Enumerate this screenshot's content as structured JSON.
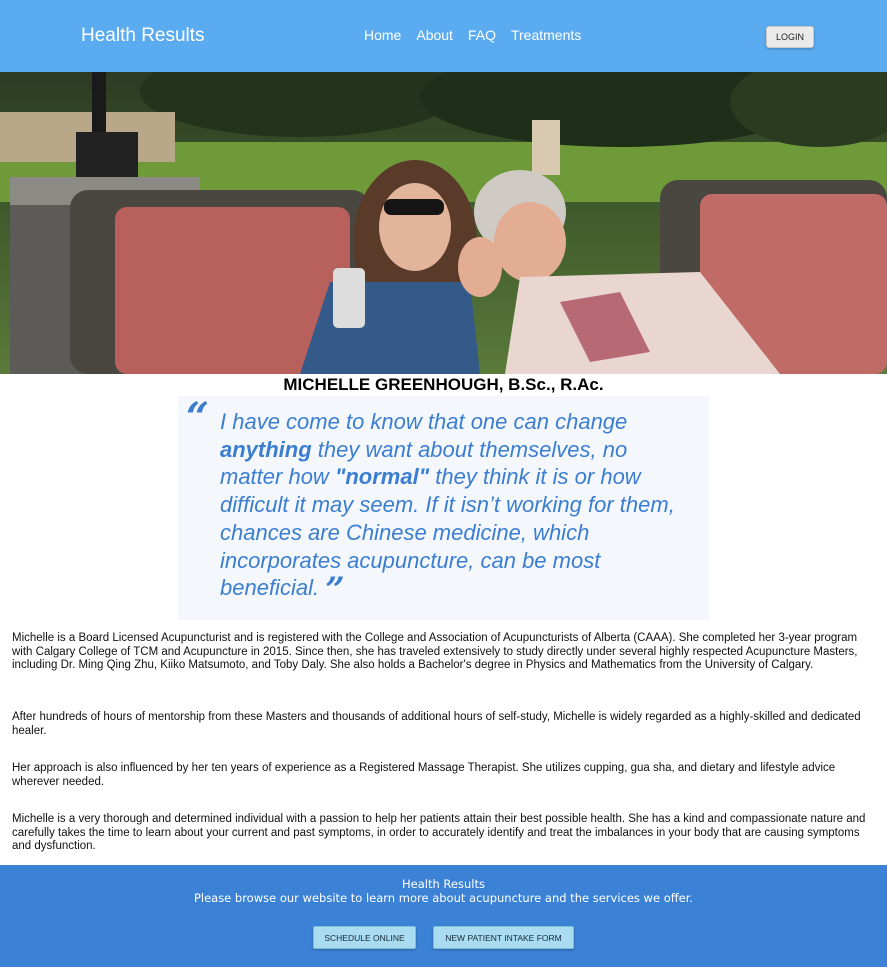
{
  "header": {
    "brand": "Health Results",
    "nav": [
      "Home",
      "About",
      "FAQ",
      "Treatments"
    ],
    "login_label": "LOGIN"
  },
  "profile": {
    "name": "MICHELLE GREENHOUGH, B.Sc., R.Ac.",
    "quote_open_mark": "“",
    "quote_close_mark": "”",
    "quote_parts": [
      "I have come to know that one can change ",
      "anything",
      " they want about themselves, no matter how ",
      "\"normal\"",
      " they think it is or how difficult it may seem. If it isn’t working for them, chances are Chinese medicine, which incorporates acupuncture, can be most beneficial. "
    ],
    "bio": [
      "Michelle is a Board Licensed Acupuncturist and is registered with the College and Association of Acupuncturists of Alberta (CAAA). She completed her 3-year program with Calgary College of TCM and Acupuncture in 2015. Since then, she has traveled extensively to study directly under several highly respected Acupuncture Masters, including Dr. Ming Qing Zhu, Kiiko Matsumoto, and Toby Daly. She also holds a Bachelor's degree in Physics and Mathematics from the University of Calgary.",
      "After hundreds of hours of mentorship from these Masters and thousands of additional hours of self-study, Michelle is widely regarded as a highly-skilled and dedicated healer.",
      "Her approach is also influenced by her ten years of experience as a Registered Massage Therapist. She utilizes cupping, gua sha, and dietary and lifestyle advice wherever needed.",
      "Michelle is a very thorough and determined individual with a passion to help her patients attain their best possible health. She has a kind and compassionate nature and carefully takes the time to learn about your current and past symptoms, in order to accurately identify and treat the imbalances in your body that are causing symptoms and dysfunction."
    ]
  },
  "footer": {
    "title": "Health Results",
    "subtitle": "Please browse our website to learn more about acupuncture and the services we offer.",
    "schedule_label": "SCHEDULE ONLINE",
    "intake_label": "NEW PATIENT INTAKE FORM"
  },
  "colors": {
    "header_bg": "#5aabf0",
    "footer_bg": "#3b82d6",
    "quote_text": "#3b7dd0",
    "quote_bg": "#f4f8fd"
  }
}
